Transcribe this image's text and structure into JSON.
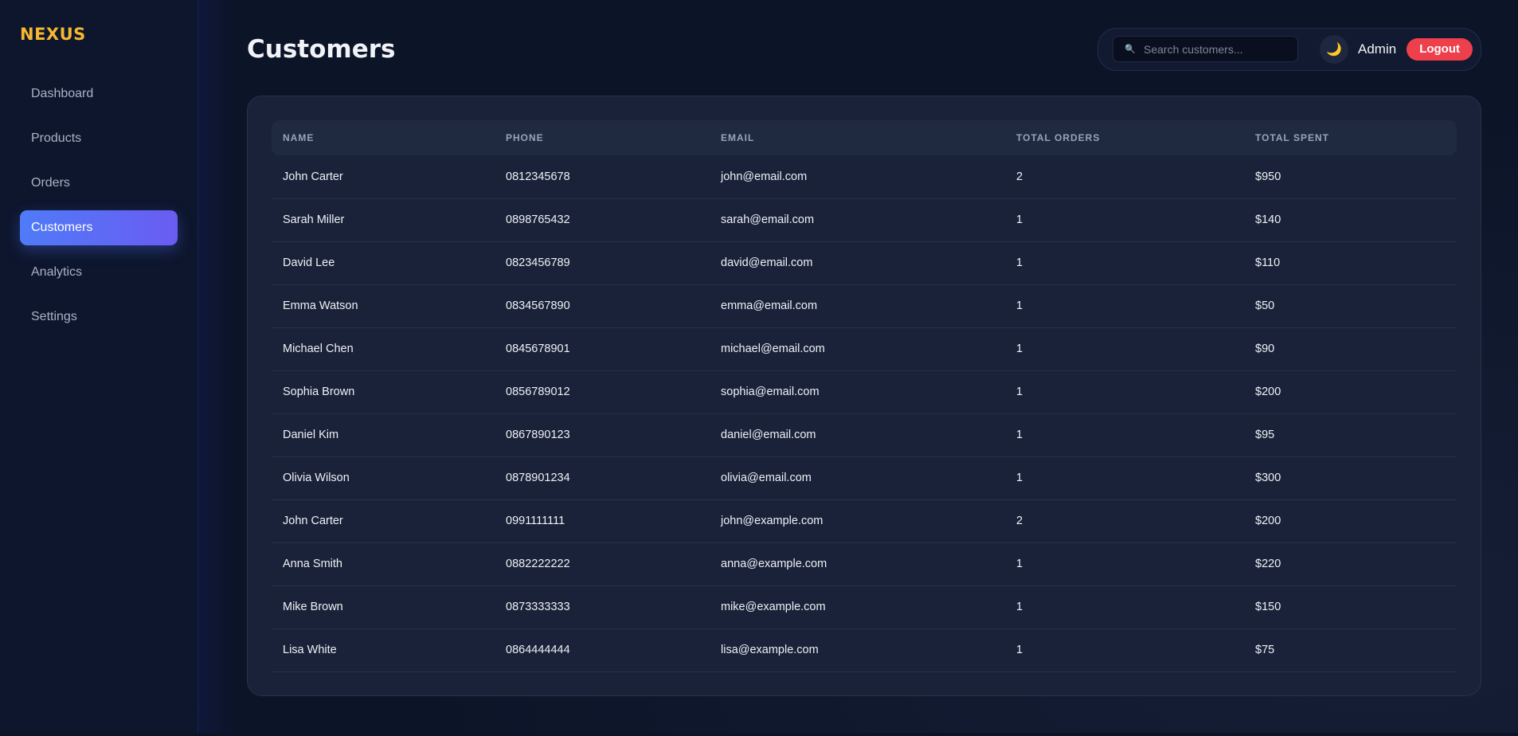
{
  "sidebar": {
    "logo": "NEXUS",
    "items": [
      {
        "label": "Dashboard"
      },
      {
        "label": "Products"
      },
      {
        "label": "Orders"
      },
      {
        "label": "Customers",
        "active": true
      },
      {
        "label": "Analytics"
      },
      {
        "label": "Settings"
      }
    ]
  },
  "header": {
    "title": "Customers",
    "search_placeholder": "Search customers...",
    "search_value": "",
    "theme_icon": "moon-icon",
    "user": "Admin",
    "logout_label": "Logout"
  },
  "table": {
    "columns": [
      "NAME",
      "PHONE",
      "EMAIL",
      "TOTAL ORDERS",
      "TOTAL SPENT"
    ],
    "rows": [
      [
        "John Carter",
        "0812345678",
        "john@email.com",
        "2",
        "$950"
      ],
      [
        "Sarah Miller",
        "0898765432",
        "sarah@email.com",
        "1",
        "$140"
      ],
      [
        "David Lee",
        "0823456789",
        "david@email.com",
        "1",
        "$110"
      ],
      [
        "Emma Watson",
        "0834567890",
        "emma@email.com",
        "1",
        "$50"
      ],
      [
        "Michael Chen",
        "0845678901",
        "michael@email.com",
        "1",
        "$90"
      ],
      [
        "Sophia Brown",
        "0856789012",
        "sophia@email.com",
        "1",
        "$200"
      ],
      [
        "Daniel Kim",
        "0867890123",
        "daniel@email.com",
        "1",
        "$95"
      ],
      [
        "Olivia Wilson",
        "0878901234",
        "olivia@email.com",
        "1",
        "$300"
      ],
      [
        "John Carter",
        "0991111111",
        "john@example.com",
        "2",
        "$200"
      ],
      [
        "Anna Smith",
        "0882222222",
        "anna@example.com",
        "1",
        "$220"
      ],
      [
        "Mike Brown",
        "0873333333",
        "mike@example.com",
        "1",
        "$150"
      ],
      [
        "Lisa White",
        "0864444444",
        "lisa@example.com",
        "1",
        "$75"
      ]
    ]
  },
  "colors": {
    "accent": "#5b6cf5",
    "logo": "#f5b82e",
    "logout": "#ee3f4c",
    "background": "#0c1428"
  }
}
